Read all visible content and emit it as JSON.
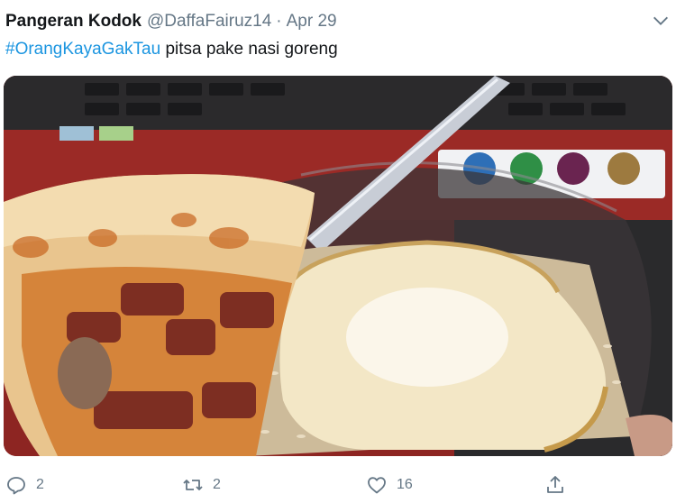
{
  "tweet": {
    "display_name": "Pangeran Kodok",
    "handle": "@DaffaFairuz14",
    "separator": "·",
    "date": "Apr 29",
    "hashtag": "#OrangKayaGakTau",
    "body": " pitsa pake nasi goreng"
  },
  "actions": {
    "reply_count": "2",
    "retweet_count": "2",
    "like_count": "16"
  },
  "icons": {
    "more": "chevron-down-icon",
    "reply": "reply-icon",
    "retweet": "retweet-icon",
    "like": "heart-icon",
    "share": "share-icon"
  },
  "colors": {
    "text": "#14171a",
    "muted": "#657786",
    "link": "#1b95e0"
  }
}
